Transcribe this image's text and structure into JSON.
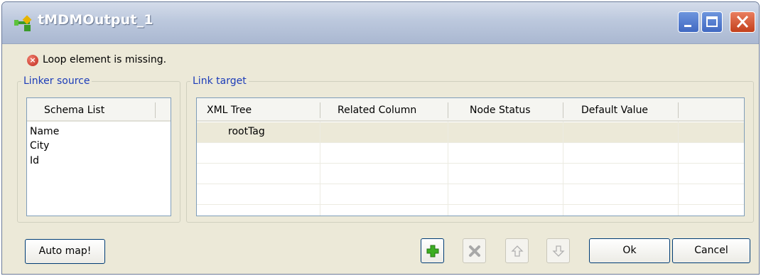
{
  "window": {
    "title": "tMDMOutput_1",
    "icon": "component-icon",
    "controls": [
      "minimize-icon",
      "maximize-icon",
      "close-icon"
    ]
  },
  "error": {
    "icon": "error-icon",
    "message": "Loop element is missing."
  },
  "linker_source": {
    "legend": "Linker source",
    "header": "Schema List",
    "items": [
      "Name",
      "City",
      "Id"
    ]
  },
  "link_target": {
    "legend": "Link target",
    "columns": [
      "XML Tree",
      "Related Column",
      "Node Status",
      "Default Value"
    ],
    "rows": [
      {
        "xml_tree": "rootTag",
        "related_column": "",
        "node_status": "",
        "default_value": "",
        "selected": true
      }
    ]
  },
  "buttons": {
    "auto_map": "Auto map!",
    "add_icon": "plus-icon",
    "remove_icon": "delete-icon",
    "move_up_icon": "arrow-up-icon",
    "move_down_icon": "arrow-down-icon",
    "ok": "Ok",
    "cancel": "Cancel"
  },
  "colors": {
    "legend": "#1c3cb8",
    "dialog_bg": "#ece9d8",
    "title_bar": "#bcc8dd",
    "close_button": "#c3401c",
    "add_icon": "#3cae22"
  }
}
